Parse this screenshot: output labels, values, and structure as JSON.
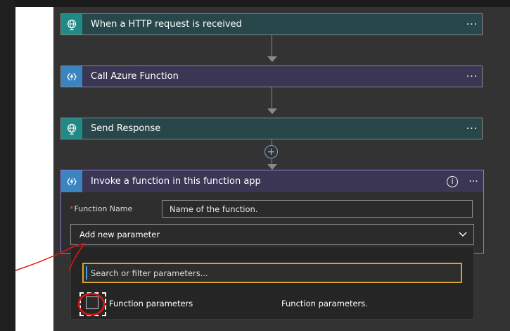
{
  "steps": [
    {
      "title": "When a HTTP request is received",
      "icon": "globe-icon"
    },
    {
      "title": "Call Azure Function",
      "icon": "azure-function-icon"
    },
    {
      "title": "Send Response",
      "icon": "globe-icon"
    }
  ],
  "more_label": "···",
  "action": {
    "title": "Invoke a function in this function app",
    "info_label": "i",
    "field_label": "Function Name",
    "required_mark": "*",
    "field_placeholder": "Name of the function.",
    "add_param_label": "Add new parameter"
  },
  "dropdown": {
    "search_placeholder": "Search or filter parameters...",
    "options": [
      {
        "name": "Function parameters",
        "description": "Function parameters."
      }
    ]
  },
  "colors": {
    "teal_header": "#27474b",
    "purple_header": "#3a3654",
    "accent_border": "#8e7fe0",
    "search_focus": "#d8a52a",
    "annotation_red": "#e01414"
  }
}
